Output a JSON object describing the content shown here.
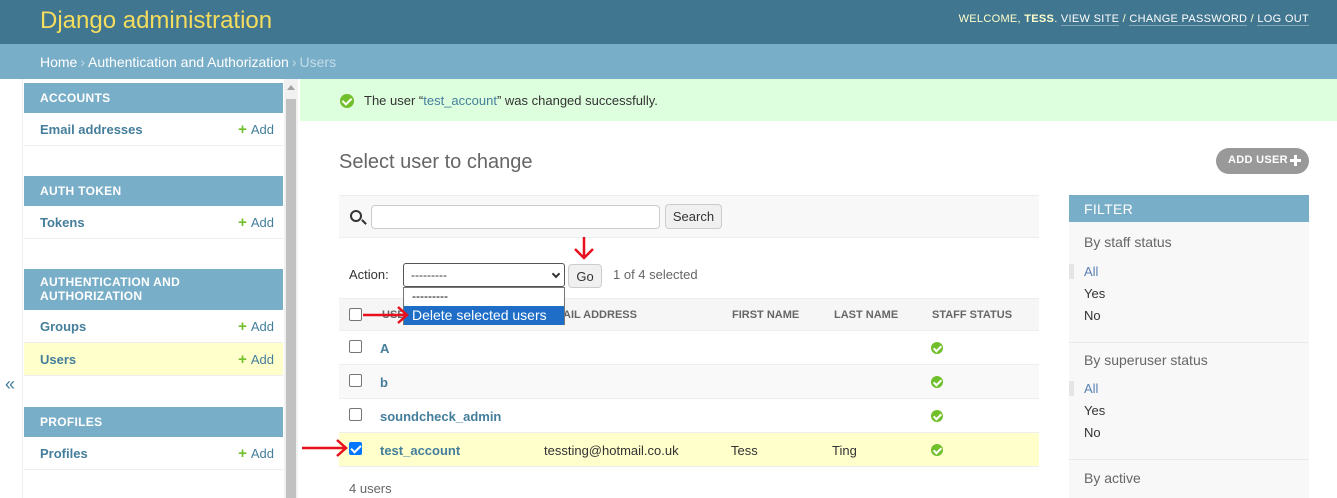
{
  "header": {
    "branding": "Django administration",
    "welcome": "Welcome,",
    "user": "Tess",
    "view_site": "View site",
    "change_password": "Change password",
    "log_out": "Log out"
  },
  "breadcrumbs": {
    "home": "Home",
    "app": "Authentication and Authorization",
    "current": "Users",
    "separator": "›"
  },
  "nav_toggle": "«",
  "sidebar": {
    "modules": [
      {
        "caption": "Accounts",
        "rows": [
          {
            "label": "Email addresses",
            "add": "Add"
          }
        ]
      },
      {
        "caption": "Auth Token",
        "rows": [
          {
            "label": "Tokens",
            "add": "Add"
          }
        ]
      },
      {
        "caption": "Authentication and Authorization",
        "rows": [
          {
            "label": "Groups",
            "add": "Add"
          },
          {
            "label": "Users",
            "add": "Add",
            "current": true
          }
        ]
      },
      {
        "caption": "Profiles",
        "rows": [
          {
            "label": "Profiles",
            "add": "Add"
          }
        ]
      }
    ]
  },
  "message": {
    "prefix": "The user “",
    "link": "test_account",
    "suffix": "” was changed successfully."
  },
  "title": "Select user to change",
  "add_user": "Add user",
  "search": {
    "value": "",
    "placeholder": "",
    "button": "Search"
  },
  "actions": {
    "label": "Action:",
    "selected_option": "---------",
    "options": [
      "---------",
      "Delete selected users"
    ],
    "go": "Go",
    "counter": "1 of 4 selected"
  },
  "table": {
    "headers": {
      "username": "Username",
      "username_visible": "USE",
      "email": "Email address",
      "email_visible": "AIL ADDRESS",
      "first_name": "First name",
      "last_name": "Last name",
      "staff": "Staff status"
    },
    "rows": [
      {
        "username": "A",
        "email": "",
        "first_name": "",
        "last_name": "",
        "staff": true,
        "checked": false
      },
      {
        "username": "b",
        "email": "",
        "first_name": "",
        "last_name": "",
        "staff": true,
        "checked": false
      },
      {
        "username": "soundcheck_admin",
        "email": "",
        "first_name": "",
        "last_name": "",
        "staff": true,
        "checked": false
      },
      {
        "username": "test_account",
        "email": "tessting@hotmail.co.uk",
        "first_name": "Tess",
        "last_name": "Ting",
        "staff": true,
        "checked": true
      }
    ]
  },
  "paginator": "4 users",
  "filter": {
    "title": "Filter",
    "groups": [
      {
        "title": "By staff status",
        "items": [
          "All",
          "Yes",
          "No"
        ],
        "active": 0
      },
      {
        "title": "By superuser status",
        "items": [
          "All",
          "Yes",
          "No"
        ],
        "active": 0
      },
      {
        "title": "By active",
        "items": []
      }
    ]
  },
  "colors": {
    "header_bg": "#417690",
    "branding": "#f5dd5d",
    "breadcrumbs_bg": "#79aec8",
    "link": "#447e9b",
    "success_bg": "#dddddd",
    "add_green": "#70bf2b",
    "selected_row": "#ffffcc",
    "annotation_arrow": "#e8101e"
  }
}
